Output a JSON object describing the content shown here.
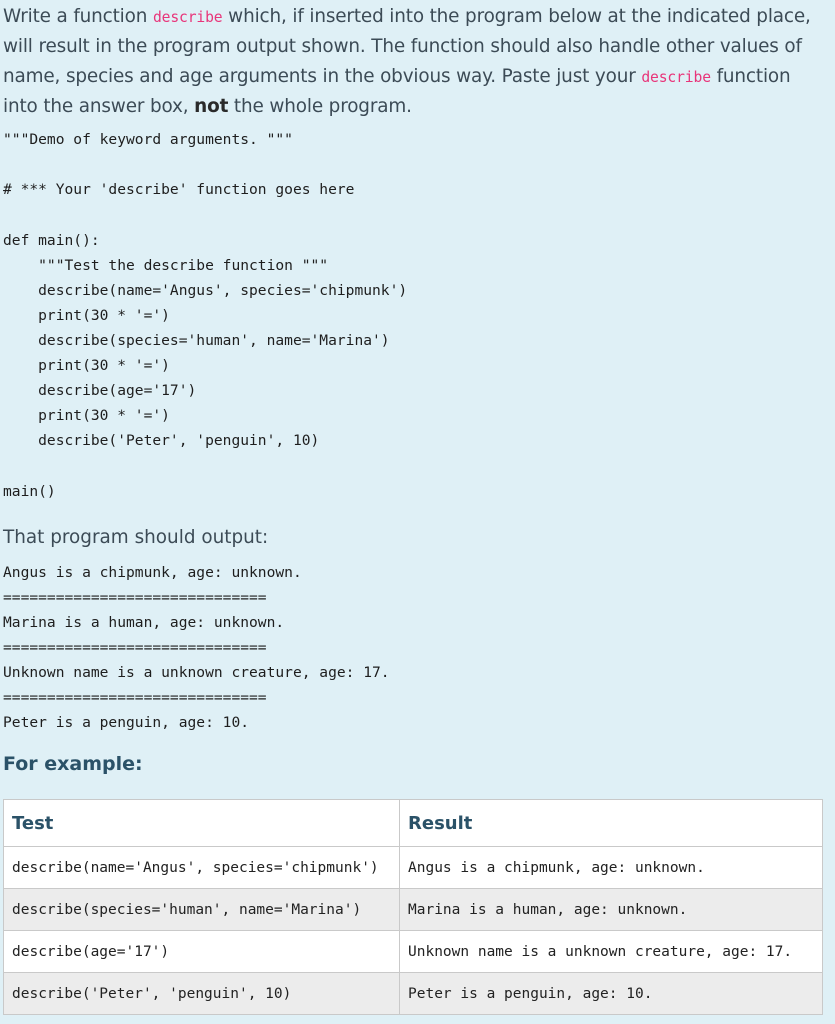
{
  "question": {
    "p1": "Write a function ",
    "fn1": "describe",
    "p2": " which, if inserted into the program below at the indicated place, will result in the program output shown. The function should also handle other values of name, species and age arguments in the obvious way. Paste just your ",
    "fn2": "describe",
    "p3": " function into the answer box, ",
    "bold": "not",
    "p4": " the whole program."
  },
  "program_code": "\"\"\"Demo of keyword arguments. \"\"\"\n\n# *** Your 'describe' function goes here\n\ndef main():\n    \"\"\"Test the describe function \"\"\"\n    describe(name='Angus', species='chipmunk')\n    print(30 * '=')\n    describe(species='human', name='Marina')\n    print(30 * '=')\n    describe(age='17')\n    print(30 * '=')\n    describe('Peter', 'penguin', 10)\n\nmain()",
  "output_heading": "That program should output:",
  "output_text": "Angus is a chipmunk, age: unknown.\n==============================\nMarina is a human, age: unknown.\n==============================\nUnknown name is a unknown creature, age: 17.\n==============================\nPeter is a penguin, age: 10.",
  "example_heading": "For example:",
  "table": {
    "headers": [
      "Test",
      "Result"
    ],
    "rows": [
      [
        "describe(name='Angus', species='chipmunk')",
        "Angus is a chipmunk, age: unknown."
      ],
      [
        "describe(species='human', name='Marina')",
        "Marina is a human, age: unknown."
      ],
      [
        "describe(age='17')",
        "Unknown name is a unknown creature, age: 17."
      ],
      [
        "describe('Peter', 'penguin', 10)",
        "Peter is a penguin, age: 10."
      ]
    ]
  }
}
